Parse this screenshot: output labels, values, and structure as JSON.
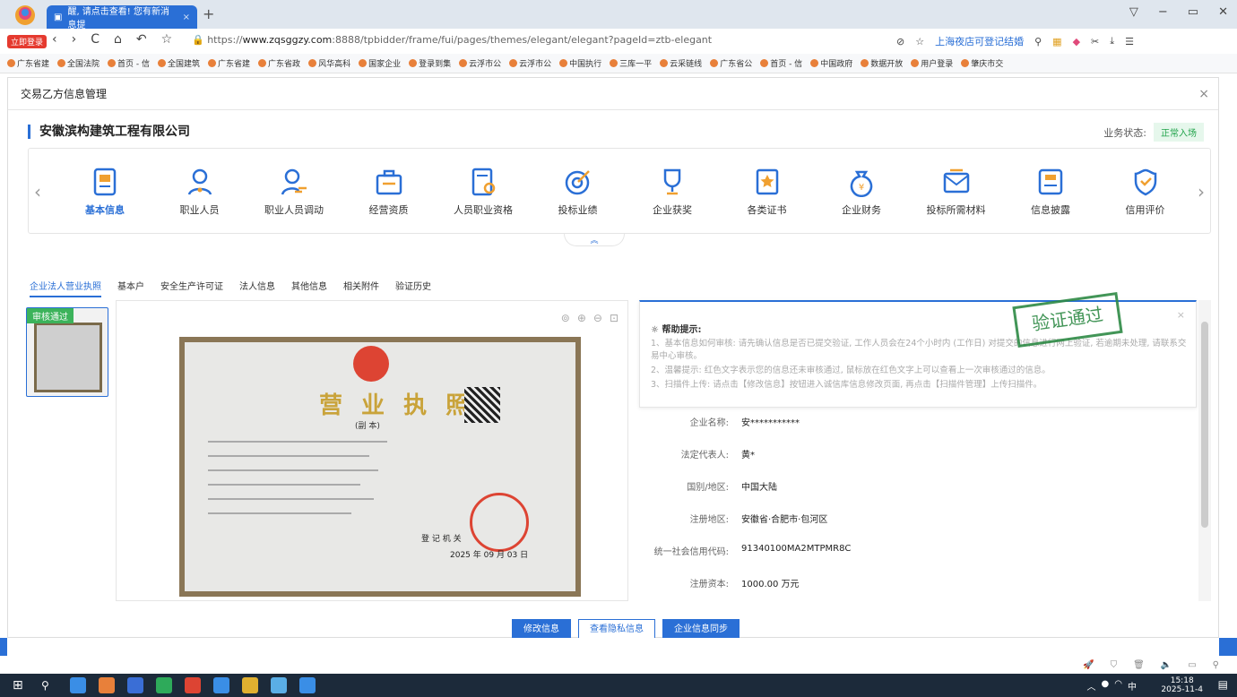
{
  "browser": {
    "tab_title": "醒, 请点击查看! 您有新消息提",
    "tab_close": "×",
    "new_tab": "+",
    "login_badge": "立即登录",
    "url_prefix": "https://",
    "url_host": "www.zqsggzy.com",
    "url_path": ":8888/tpbidder/frame/fui/pages/themes/elegant/elegant?pageId=ztb-elegant",
    "addr_hint": "上海夜店可登记结婚",
    "window_controls": [
      "▽",
      "−",
      "▭",
      "✕"
    ],
    "nav": [
      "‹",
      "›",
      "C",
      "⌂",
      "↶",
      "☆"
    ]
  },
  "bookmarks": [
    "广东省建",
    "全国法院",
    "首页 - 信",
    "全国建筑",
    "广东省建",
    "广东省政",
    "风华高科",
    "国家企业",
    "登录到集",
    "云浮市公",
    "云浮市公",
    "中国执行",
    "三库一平",
    "云采链线",
    "广东省公",
    "首页 - 信",
    "中国政府",
    "数据开放",
    "用户登录",
    "肇庆市交"
  ],
  "dialog": {
    "title": "交易乙方信息管理",
    "close": "×"
  },
  "company": {
    "name": "安徽滨构建筑工程有限公司",
    "status_label": "业务状态:",
    "status_value": "正常入场"
  },
  "icon_strip": {
    "items": [
      {
        "label": "基本信息",
        "icon": "basic-info-icon",
        "active": true
      },
      {
        "label": "职业人员",
        "icon": "person-icon"
      },
      {
        "label": "职业人员调动",
        "icon": "person-transfer-icon"
      },
      {
        "label": "经营资质",
        "icon": "briefcase-icon"
      },
      {
        "label": "人员职业资格",
        "icon": "certificate-doc-icon"
      },
      {
        "label": "投标业绩",
        "icon": "target-icon"
      },
      {
        "label": "企业获奖",
        "icon": "trophy-icon"
      },
      {
        "label": "各类证书",
        "icon": "star-cert-icon"
      },
      {
        "label": "企业财务",
        "icon": "money-bag-icon"
      },
      {
        "label": "投标所需材料",
        "icon": "mail-icon"
      },
      {
        "label": "信息披露",
        "icon": "disclosure-icon"
      },
      {
        "label": "信用评价",
        "icon": "credit-icon"
      }
    ],
    "collapse": "︽"
  },
  "subtabs": [
    "企业法人营业执照",
    "基本户",
    "安全生产许可证",
    "法人信息",
    "其他信息",
    "相关附件",
    "验证历史"
  ],
  "thumb": {
    "badge": "审核通过"
  },
  "cert": {
    "title": "营 业 执 照",
    "subtitle": "(副 本)",
    "issuer": "登 记 机 关",
    "date": "2025 年 09 月 03 日"
  },
  "help": {
    "title": "帮助提示:",
    "lines": [
      "1、基本信息如何审核: 请先确认信息是否已提交验证, 工作人员会在24个小时内 (工作日) 对提交的信息进行网上验证, 若逾期未处理, 请联系交易中心审核。",
      "2、温馨提示: 红色文字表示您的信息还未审核通过, 鼠标放在红色文字上可以查看上一次审核通过的信息。",
      "3、扫描件上传: 请点击【修改信息】按钮进入诚信库信息修改页面, 再点击【扫描件管理】上传扫描件。"
    ],
    "stamp": "验证通过"
  },
  "fields": [
    {
      "label": "企业名称:",
      "value": "安***********"
    },
    {
      "label": "法定代表人:",
      "value": "黄*"
    },
    {
      "label": "国别/地区:",
      "value": "中国大陆"
    },
    {
      "label": "注册地区:",
      "value": "安徽省·合肥市·包河区"
    },
    {
      "label": "统一社会信用代码:",
      "value": "91340100MA2MTPMR8C"
    },
    {
      "label": "注册资本:",
      "value": "1000.00 万元"
    }
  ],
  "buttons": {
    "edit": "修改信息",
    "privacy": "查看隐私信息",
    "sync": "企业信息同步"
  },
  "taskbar": {
    "time": "15:18",
    "date": "2025-11-4",
    "ime": "中"
  }
}
